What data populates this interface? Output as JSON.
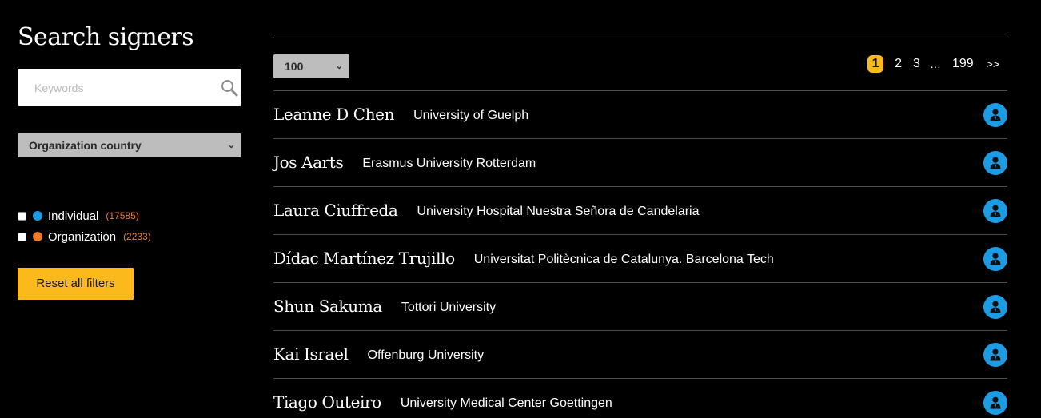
{
  "sidebar": {
    "title": "Search signers",
    "search": {
      "placeholder": "Keywords",
      "value": "",
      "icon": "search-icon"
    },
    "country_filter": {
      "label": "Organization country"
    },
    "type_filters": [
      {
        "label": "Individual",
        "count": "(17585)",
        "color": "#1e9ce3",
        "checked": false
      },
      {
        "label": "Organization",
        "count": "(2233)",
        "color": "#ef7a2a",
        "checked": false
      }
    ],
    "reset_label": "Reset all filters"
  },
  "toolbar": {
    "per_page": "100",
    "pagination": {
      "current": "1",
      "pages": [
        "2",
        "3"
      ],
      "ellipsis": "…",
      "last": "199",
      "next": ">>"
    }
  },
  "signers": [
    {
      "name": "Leanne D Chen",
      "organization": "University of Guelph"
    },
    {
      "name": "Jos Aarts",
      "organization": "Erasmus University Rotterdam"
    },
    {
      "name": "Laura Ciuffreda",
      "organization": "University Hospital Nuestra Señora de Candelaria"
    },
    {
      "name": "Dídac Martínez Trujillo",
      "organization": "Universitat Politècnica de Catalunya. Barcelona Tech"
    },
    {
      "name": "Shun Sakuma",
      "organization": "Tottori University"
    },
    {
      "name": "Kai Israel",
      "organization": "Offenburg University"
    },
    {
      "name": "Tiago Outeiro",
      "organization": "University Medical Center Goettingen"
    }
  ],
  "colors": {
    "accent": "#fbb91b",
    "individual": "#1e9ce3",
    "organization": "#ef7a2a",
    "background": "#000000"
  }
}
